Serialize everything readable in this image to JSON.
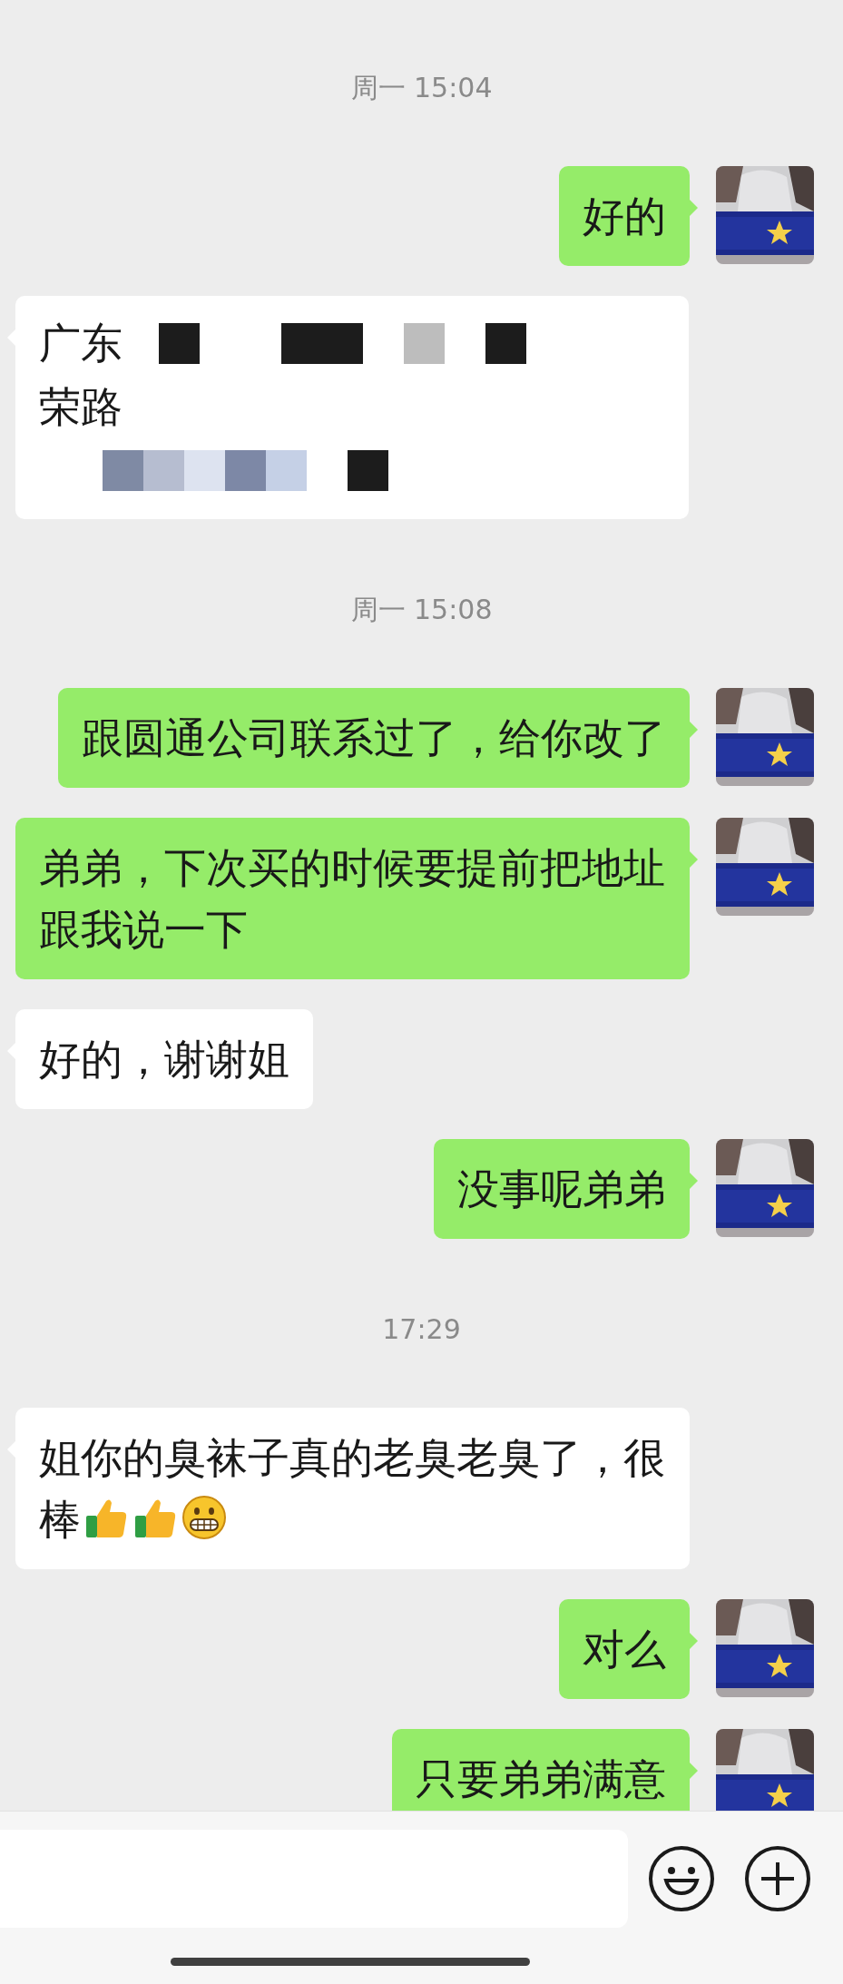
{
  "timeline": [
    {
      "kind": "time",
      "text": "周一 15:04"
    },
    {
      "kind": "sent",
      "text": "好的"
    },
    {
      "kind": "received_redacted",
      "visible_lines": [
        "广东",
        "荣路"
      ]
    },
    {
      "kind": "time",
      "text": "周一 15:08"
    },
    {
      "kind": "sent",
      "text": "跟圆通公司联系过了，给你改了"
    },
    {
      "kind": "sent",
      "text": "弟弟，下次买的时候要提前把地址跟我说一下"
    },
    {
      "kind": "received",
      "text": "好的，谢谢姐"
    },
    {
      "kind": "sent",
      "text": "没事呢弟弟"
    },
    {
      "kind": "time",
      "text": "17:29"
    },
    {
      "kind": "received",
      "text": "姐你的臭袜子真的老臭老臭了，很棒",
      "emojis": [
        {
          "kind": "thumbs_up"
        },
        {
          "kind": "thumbs_up"
        },
        {
          "kind": "grin"
        }
      ]
    },
    {
      "kind": "sent",
      "text": "对么"
    },
    {
      "kind": "sent",
      "text": "只要弟弟满意"
    }
  ]
}
